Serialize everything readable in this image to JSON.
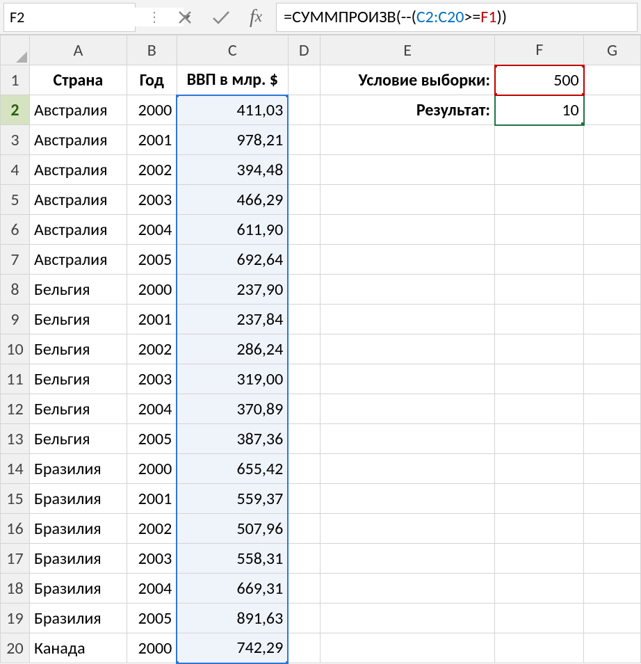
{
  "nameBox": "F2",
  "formula": {
    "prefix": "=СУММПРОИЗВ(--(",
    "range": "C2:C20",
    "op": ">=",
    "ref": "F1",
    "suffix": "))"
  },
  "cols": [
    "A",
    "B",
    "C",
    "D",
    "E",
    "F",
    "G"
  ],
  "headers": {
    "A": "Страна",
    "B": "Год",
    "C": "ВВП в млр. $"
  },
  "labels": {
    "E1": "Условие выборки:",
    "E2": "Результат:"
  },
  "values": {
    "F1": "500",
    "F2": "10"
  },
  "rows": [
    {
      "n": 1
    },
    {
      "n": 2,
      "a": "Австралия",
      "b": "2000",
      "c": "411,03"
    },
    {
      "n": 3,
      "a": "Австралия",
      "b": "2001",
      "c": "978,21"
    },
    {
      "n": 4,
      "a": "Австралия",
      "b": "2002",
      "c": "394,48"
    },
    {
      "n": 5,
      "a": "Австралия",
      "b": "2003",
      "c": "466,29"
    },
    {
      "n": 6,
      "a": "Австралия",
      "b": "2004",
      "c": "611,90"
    },
    {
      "n": 7,
      "a": "Австралия",
      "b": "2005",
      "c": "692,64"
    },
    {
      "n": 8,
      "a": "Бельгия",
      "b": "2000",
      "c": "237,90"
    },
    {
      "n": 9,
      "a": "Бельгия",
      "b": "2001",
      "c": "237,84"
    },
    {
      "n": 10,
      "a": "Бельгия",
      "b": "2002",
      "c": "286,24"
    },
    {
      "n": 11,
      "a": "Бельгия",
      "b": "2003",
      "c": "319,00"
    },
    {
      "n": 12,
      "a": "Бельгия",
      "b": "2004",
      "c": "370,89"
    },
    {
      "n": 13,
      "a": "Бельгия",
      "b": "2005",
      "c": "387,36"
    },
    {
      "n": 14,
      "a": "Бразилия",
      "b": "2000",
      "c": "655,42"
    },
    {
      "n": 15,
      "a": "Бразилия",
      "b": "2001",
      "c": "559,37"
    },
    {
      "n": 16,
      "a": "Бразилия",
      "b": "2002",
      "c": "507,96"
    },
    {
      "n": 17,
      "a": "Бразилия",
      "b": "2003",
      "c": "558,31"
    },
    {
      "n": 18,
      "a": "Бразилия",
      "b": "2004",
      "c": "669,31"
    },
    {
      "n": 19,
      "a": "Бразилия",
      "b": "2005",
      "c": "891,63"
    },
    {
      "n": 20,
      "a": "Канада",
      "b": "2000",
      "c": "742,29"
    }
  ]
}
